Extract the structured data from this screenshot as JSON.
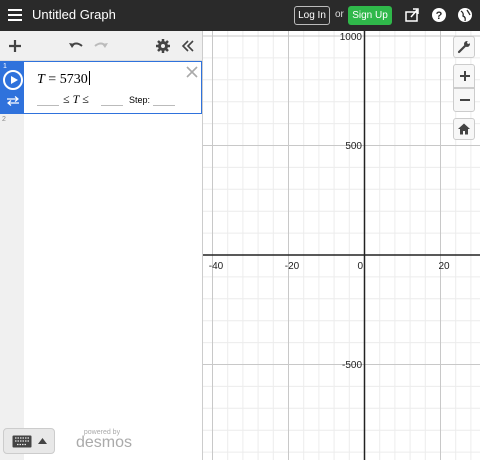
{
  "header": {
    "title": "Untitled Graph",
    "login_label": "Log In",
    "or_text": "or",
    "signup_label": "Sign Up",
    "signup_color": "#2fb84a",
    "icons": [
      "share-icon",
      "help-icon",
      "globe-icon"
    ]
  },
  "toolbar": {
    "icons": [
      "add-icon",
      "undo-icon",
      "redo-icon",
      "settings-icon",
      "collapse-icon"
    ]
  },
  "expressions": [
    {
      "index": "1",
      "latex_var": "T",
      "latex_op": " = ",
      "latex_value": "5730",
      "range_symbol": "≤ ",
      "range_var": "T",
      "range_symbol2": " ≤",
      "step_label": "Step:",
      "accent": "#2f72dc"
    },
    {
      "index": "2"
    }
  ],
  "footer": {
    "powered_by": "powered by",
    "brand": "desmos"
  },
  "graph_controls": {
    "icons": [
      "wrench-icon",
      "zoom-in-icon",
      "zoom-out-icon",
      "home-icon"
    ]
  },
  "axes": {
    "x_ticks": [
      "-40",
      "-20",
      "0",
      "20"
    ],
    "y_ticks": [
      "1000",
      "500",
      "-500"
    ]
  }
}
